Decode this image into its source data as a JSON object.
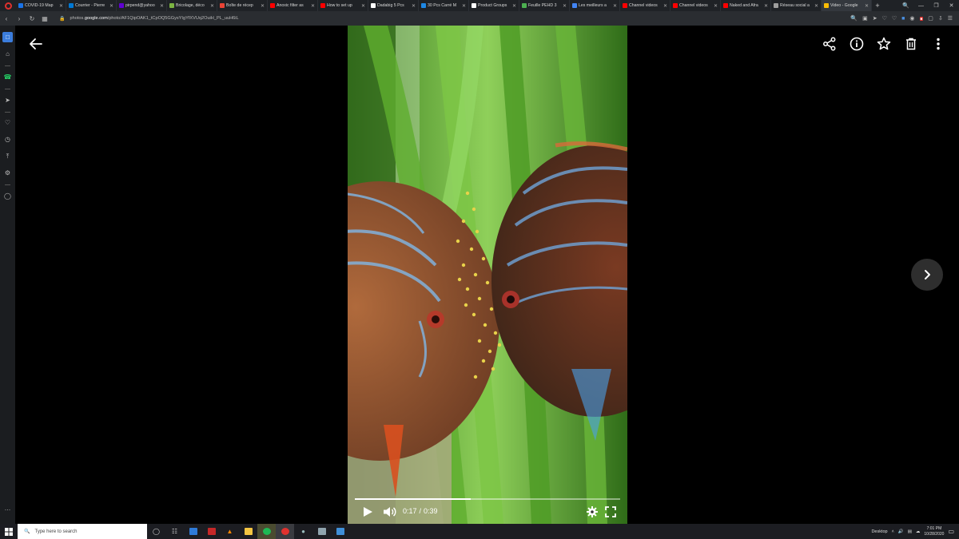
{
  "browser": {
    "tabs": [
      {
        "title": "COVID-19 Map",
        "color": "#1a73e8"
      },
      {
        "title": "Courrier - Pierre",
        "color": "#0078d4"
      },
      {
        "title": "pirpend@yahoo",
        "color": "#6001d2"
      },
      {
        "title": "Bricolage, déco",
        "color": "#7cb342"
      },
      {
        "title": "Boîte de récep",
        "color": "#ea4335"
      },
      {
        "title": "Anoxic filter as",
        "color": "#ff0000"
      },
      {
        "title": "How to set up",
        "color": "#ff0000"
      },
      {
        "title": "Dadabig 5 Pcs",
        "color": "#ffffff"
      },
      {
        "title": "30 Pcs Carré M",
        "color": "#1e88e5"
      },
      {
        "title": "Product Groups",
        "color": "#ffffff"
      },
      {
        "title": "Feuille PEHD 3",
        "color": "#4caf50"
      },
      {
        "title": "Les meilleurs a",
        "color": "#4285f4"
      },
      {
        "title": "Channel videos",
        "color": "#ff0000"
      },
      {
        "title": "Channel videos",
        "color": "#ff0000"
      },
      {
        "title": "Naked and Afra",
        "color": "#ff0000"
      },
      {
        "title": "Réseau social a",
        "color": "#9e9e9e"
      },
      {
        "title": "Video - Google",
        "color": "#fbbc04",
        "active": true
      }
    ],
    "new_tab_label": "+",
    "url_prefix": "photos.",
    "url_host": "google.com",
    "url_path": "/photo/AF1QipOAK1_tCpOQ5GGysYIgYfXVUq2OuiH_PL_uuH6iL"
  },
  "video": {
    "current_time": "0:17",
    "separator": "/",
    "duration": "0:39",
    "progress": 0.436
  },
  "taskbar": {
    "search_placeholder": "Type here to search",
    "desktop_label": "Desktop",
    "time": "7:01 PM",
    "date": "10/28/2020"
  },
  "colors": {
    "accent": "#3b7ddd",
    "opera_red": "#e0312e"
  }
}
